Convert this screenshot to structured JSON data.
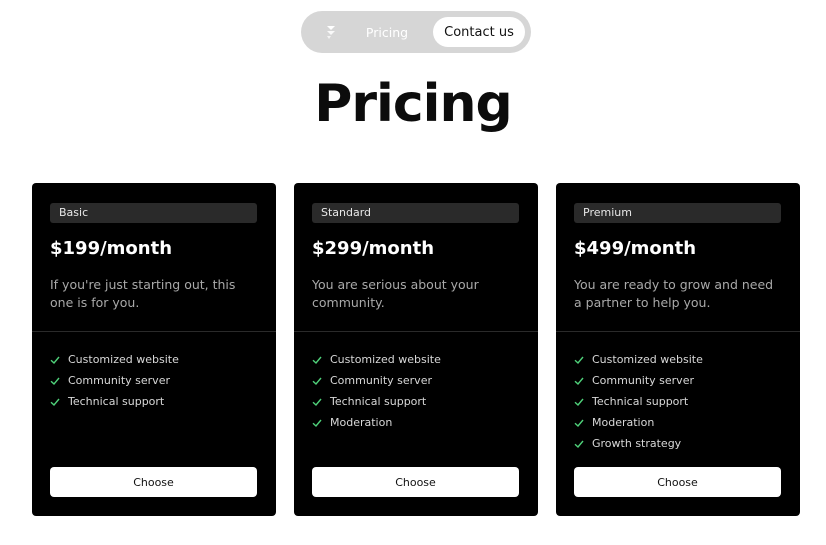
{
  "nav": {
    "logo_icon": "logo-icon",
    "link_label": "Pricing",
    "cta_label": "Contact us"
  },
  "page": {
    "title": "Pricing"
  },
  "colors": {
    "accent": "#4fd17a",
    "card_bg": "#000000"
  },
  "plans": [
    {
      "tier": "Basic",
      "price": "$199/month",
      "description": "If you're just starting out, this one is for you.",
      "features": [
        "Customized website",
        "Community server",
        "Technical support"
      ],
      "button_label": "Choose"
    },
    {
      "tier": "Standard",
      "price": "$299/month",
      "description": "You are serious about your community.",
      "features": [
        "Customized website",
        "Community server",
        "Technical support",
        "Moderation"
      ],
      "button_label": "Choose"
    },
    {
      "tier": "Premium",
      "price": "$499/month",
      "description": "You are ready to grow and need a partner to help you.",
      "features": [
        "Customized website",
        "Community server",
        "Technical support",
        "Moderation",
        "Growth strategy"
      ],
      "button_label": "Choose"
    }
  ]
}
